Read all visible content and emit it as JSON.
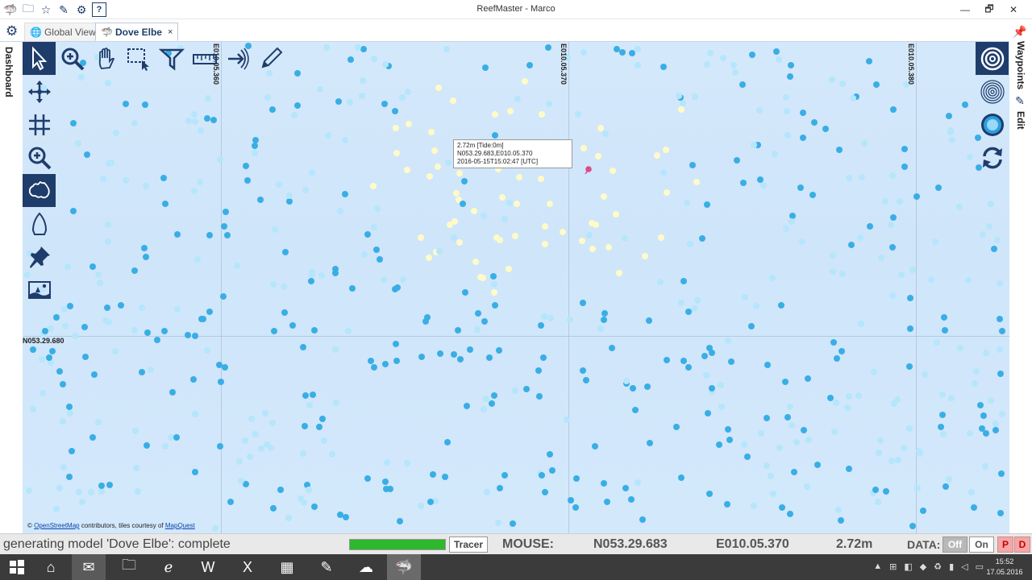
{
  "window": {
    "title": "ReefMaster - Marco",
    "help_label": "?",
    "minimize": "—",
    "restore": "🗗",
    "close": "✕"
  },
  "tabs": [
    {
      "label": "Global View",
      "icon": "globe-icon"
    },
    {
      "label": "Dove Elbe",
      "icon": "reefmaster-icon",
      "close": "×"
    }
  ],
  "panels": {
    "left_label": "Dashboard",
    "right_items": [
      {
        "label": "Waypoints",
        "icon": "pin-icon"
      },
      {
        "label": "Edit",
        "icon": "pencil-icon"
      }
    ]
  },
  "map": {
    "longitude_labels": [
      "E010.05.360",
      "E010.05.370",
      "E010.05.380"
    ],
    "latitude_label": "N053.29.680",
    "tooltip": {
      "depth": "2.72m [Tide:0m]",
      "position": "N053.29.683,E010.05.370",
      "time": "2016-05-15T15:02:47 [UTC]"
    },
    "attribution": {
      "prefix": "© ",
      "osm": "OpenStreetMap",
      "middle": " contributors, tiles courtesy of ",
      "mq": "MapQuest"
    },
    "colors": {
      "water": "#d2e7fa",
      "sounding_shallow": "#fffbc8",
      "sounding_mid": "#b5e6fb",
      "sounding_deep": "#39aee5",
      "pin": "#d94c8c"
    }
  },
  "toolbar": {
    "top": [
      "select-tool",
      "zoom-tool",
      "pan-tool",
      "box-select-tool",
      "filter-tool",
      "measure-tool",
      "trace-tool",
      "draw-tool"
    ],
    "left": [
      "move-tool",
      "grid-tool",
      "zoom-extents-tool",
      "shape-outline-tool",
      "boat-tool",
      "waypoint-pin-tool",
      "image-tool"
    ],
    "right": [
      "contour-ring-tool",
      "contour-lines-tool",
      "sonar-point-tool",
      "refresh-tool"
    ]
  },
  "status": {
    "message": "generating model 'Dove Elbe': complete",
    "progress": 1.0,
    "tracer_label": "Tracer",
    "mouse_label": "MOUSE:",
    "latitude": "N053.29.683",
    "longitude": "E010.05.370",
    "depth": "2.72m",
    "data_label": "DATA:",
    "off_label": "Off",
    "on_label": "On",
    "p_label": "P",
    "d_label": "D"
  },
  "taskbar": {
    "time": "15:52",
    "date": "17.05.2016",
    "apps": [
      "start-icon",
      "home-icon",
      "outlook-icon",
      "explorer-icon",
      "edge-icon",
      "word-icon",
      "excel-icon",
      "calculator-icon",
      "paint-icon",
      "cloud-app-icon",
      "reefmaster-icon"
    ]
  }
}
